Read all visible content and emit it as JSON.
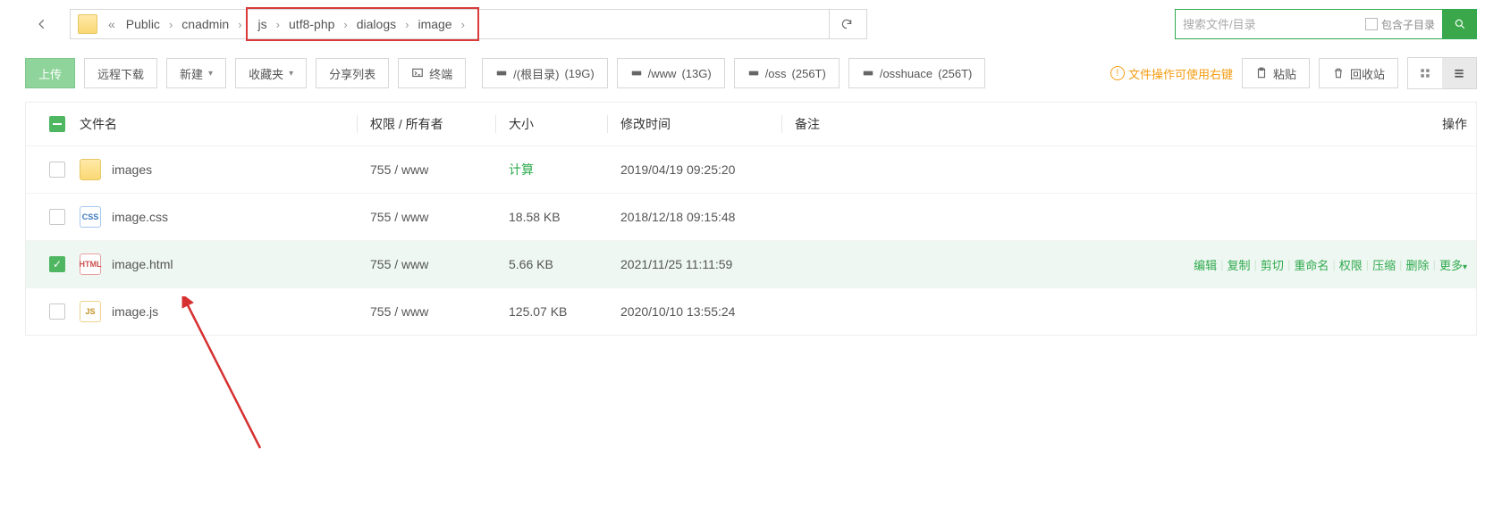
{
  "breadcrumb": {
    "items": [
      "Public",
      "cnadmin",
      "js",
      "utf8-php",
      "dialogs",
      "image"
    ],
    "highlight_start_index": 2
  },
  "search": {
    "placeholder": "搜索文件/目录",
    "subdir_label": "包含子目录"
  },
  "toolbar": {
    "upload": "上传",
    "remote": "远程下载",
    "new": "新建",
    "fav": "收藏夹",
    "share": "分享列表",
    "terminal": "终端",
    "storages": [
      {
        "label": "/(根目录)",
        "size": "(19G)"
      },
      {
        "label": "/www",
        "size": "(13G)"
      },
      {
        "label": "/oss",
        "size": "(256T)"
      },
      {
        "label": "/osshuace",
        "size": "(256T)"
      }
    ],
    "hint": "文件操作可使用右键",
    "paste": "粘贴",
    "recycle": "回收站"
  },
  "columns": {
    "name": "文件名",
    "perm": "权限 / 所有者",
    "size": "大小",
    "time": "修改时间",
    "note": "备注",
    "ops": "操作"
  },
  "rows": [
    {
      "type": "folder",
      "name": "images",
      "perm": "755 / www",
      "size_calc": "计算",
      "time": "2019/04/19 09:25:20",
      "selected": false
    },
    {
      "type": "css",
      "name": "image.css",
      "perm": "755 / www",
      "size": "18.58 KB",
      "time": "2018/12/18 09:15:48",
      "selected": false
    },
    {
      "type": "html",
      "name": "image.html",
      "perm": "755 / www",
      "size": "5.66 KB",
      "time": "2021/11/25 11:11:59",
      "selected": true
    },
    {
      "type": "js",
      "name": "image.js",
      "perm": "755 / www",
      "size": "125.07 KB",
      "time": "2020/10/10 13:55:24",
      "selected": false
    }
  ],
  "row_actions": [
    "编辑",
    "复制",
    "剪切",
    "重命名",
    "权限",
    "压缩",
    "删除",
    "更多"
  ],
  "icons": {
    "css": "CSS",
    "html": "HTML",
    "js": "JS"
  }
}
